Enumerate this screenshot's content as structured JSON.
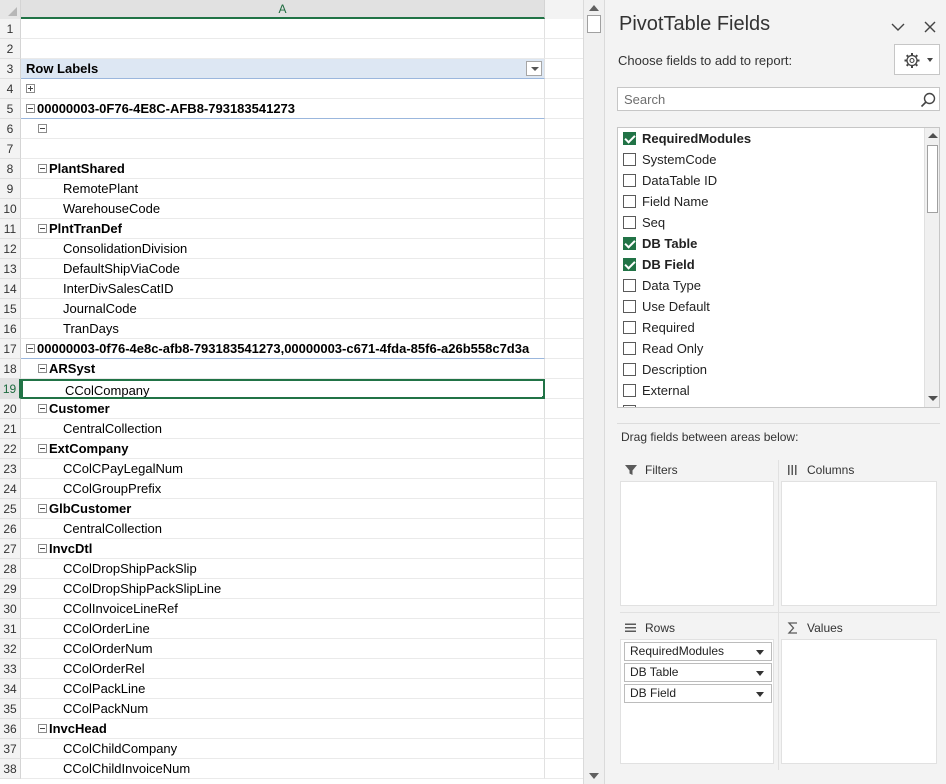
{
  "sheet": {
    "column_a": "A",
    "row_numbers": [
      "1",
      "2",
      "3",
      "4",
      "5",
      "6",
      "7",
      "8",
      "9",
      "10",
      "11",
      "12",
      "13",
      "14",
      "15",
      "16",
      "17",
      "18",
      "19",
      "20",
      "21",
      "22",
      "23",
      "24",
      "25",
      "26",
      "27",
      "28",
      "29",
      "30",
      "31",
      "32",
      "33",
      "34",
      "35",
      "36",
      "37",
      "38"
    ],
    "row_labels_header": "Row Labels",
    "rows": [
      {
        "text": ""
      },
      {
        "text": ""
      },
      {
        "text": "Row Labels"
      },
      {
        "text": ""
      },
      {
        "text": "00000003-0F76-4E8C-AFB8-793183541273"
      },
      {
        "text": ""
      },
      {
        "text": ""
      },
      {
        "text": "PlantShared"
      },
      {
        "text": "RemotePlant"
      },
      {
        "text": "WarehouseCode"
      },
      {
        "text": "PlntTranDef"
      },
      {
        "text": "ConsolidationDivision"
      },
      {
        "text": "DefaultShipViaCode"
      },
      {
        "text": "InterDivSalesCatID"
      },
      {
        "text": "JournalCode"
      },
      {
        "text": "TranDays"
      },
      {
        "text": "00000003-0f76-4e8c-afb8-793183541273,00000003-c671-4fda-85f6-a26b558c7d3a"
      },
      {
        "text": "ARSyst"
      },
      {
        "text": "CColCompany"
      },
      {
        "text": "Customer"
      },
      {
        "text": "CentralCollection"
      },
      {
        "text": "ExtCompany"
      },
      {
        "text": "CColCPayLegalNum"
      },
      {
        "text": "CColGroupPrefix"
      },
      {
        "text": "GlbCustomer"
      },
      {
        "text": "CentralCollection"
      },
      {
        "text": "InvcDtl"
      },
      {
        "text": "CColDropShipPackSlip"
      },
      {
        "text": "CColDropShipPackSlipLine"
      },
      {
        "text": "CColInvoiceLineRef"
      },
      {
        "text": "CColOrderLine"
      },
      {
        "text": "CColOrderNum"
      },
      {
        "text": "CColOrderRel"
      },
      {
        "text": "CColPackLine"
      },
      {
        "text": "CColPackNum"
      },
      {
        "text": "InvcHead"
      },
      {
        "text": "CColChildCompany"
      },
      {
        "text": "CColChildInvoiceNum"
      }
    ]
  },
  "pivot": {
    "title": "PivotTable Fields",
    "choose_label": "Choose fields to add to report:",
    "search_placeholder": "Search",
    "fields": [
      {
        "label": "RequiredModules",
        "checked": true
      },
      {
        "label": "SystemCode",
        "checked": false
      },
      {
        "label": "DataTable ID",
        "checked": false
      },
      {
        "label": "Field Name",
        "checked": false
      },
      {
        "label": "Seq",
        "checked": false
      },
      {
        "label": "DB Table",
        "checked": true
      },
      {
        "label": "DB Field",
        "checked": true
      },
      {
        "label": "Data Type",
        "checked": false
      },
      {
        "label": "Use Default",
        "checked": false
      },
      {
        "label": "Required",
        "checked": false
      },
      {
        "label": "Read Only",
        "checked": false
      },
      {
        "label": "Description",
        "checked": false
      },
      {
        "label": "External",
        "checked": false
      }
    ],
    "drag_label": "Drag fields between areas below:",
    "areas": {
      "filters": "Filters",
      "columns": "Columns",
      "rows": "Rows",
      "values": "Values"
    },
    "row_fields": [
      "RequiredModules",
      "DB Table",
      "DB Field"
    ]
  },
  "colors": {
    "accent": "#217346",
    "pivot_bg": "#f3f3f3",
    "header_fill": "#dde7f3"
  },
  "icons": {
    "collapse": "chevron-down-icon",
    "close": "close-icon",
    "settings": "gear-icon",
    "search": "search-icon",
    "filter": "filter-icon",
    "columns": "columns-icon",
    "rows": "rows-icon",
    "values": "sigma-icon"
  }
}
